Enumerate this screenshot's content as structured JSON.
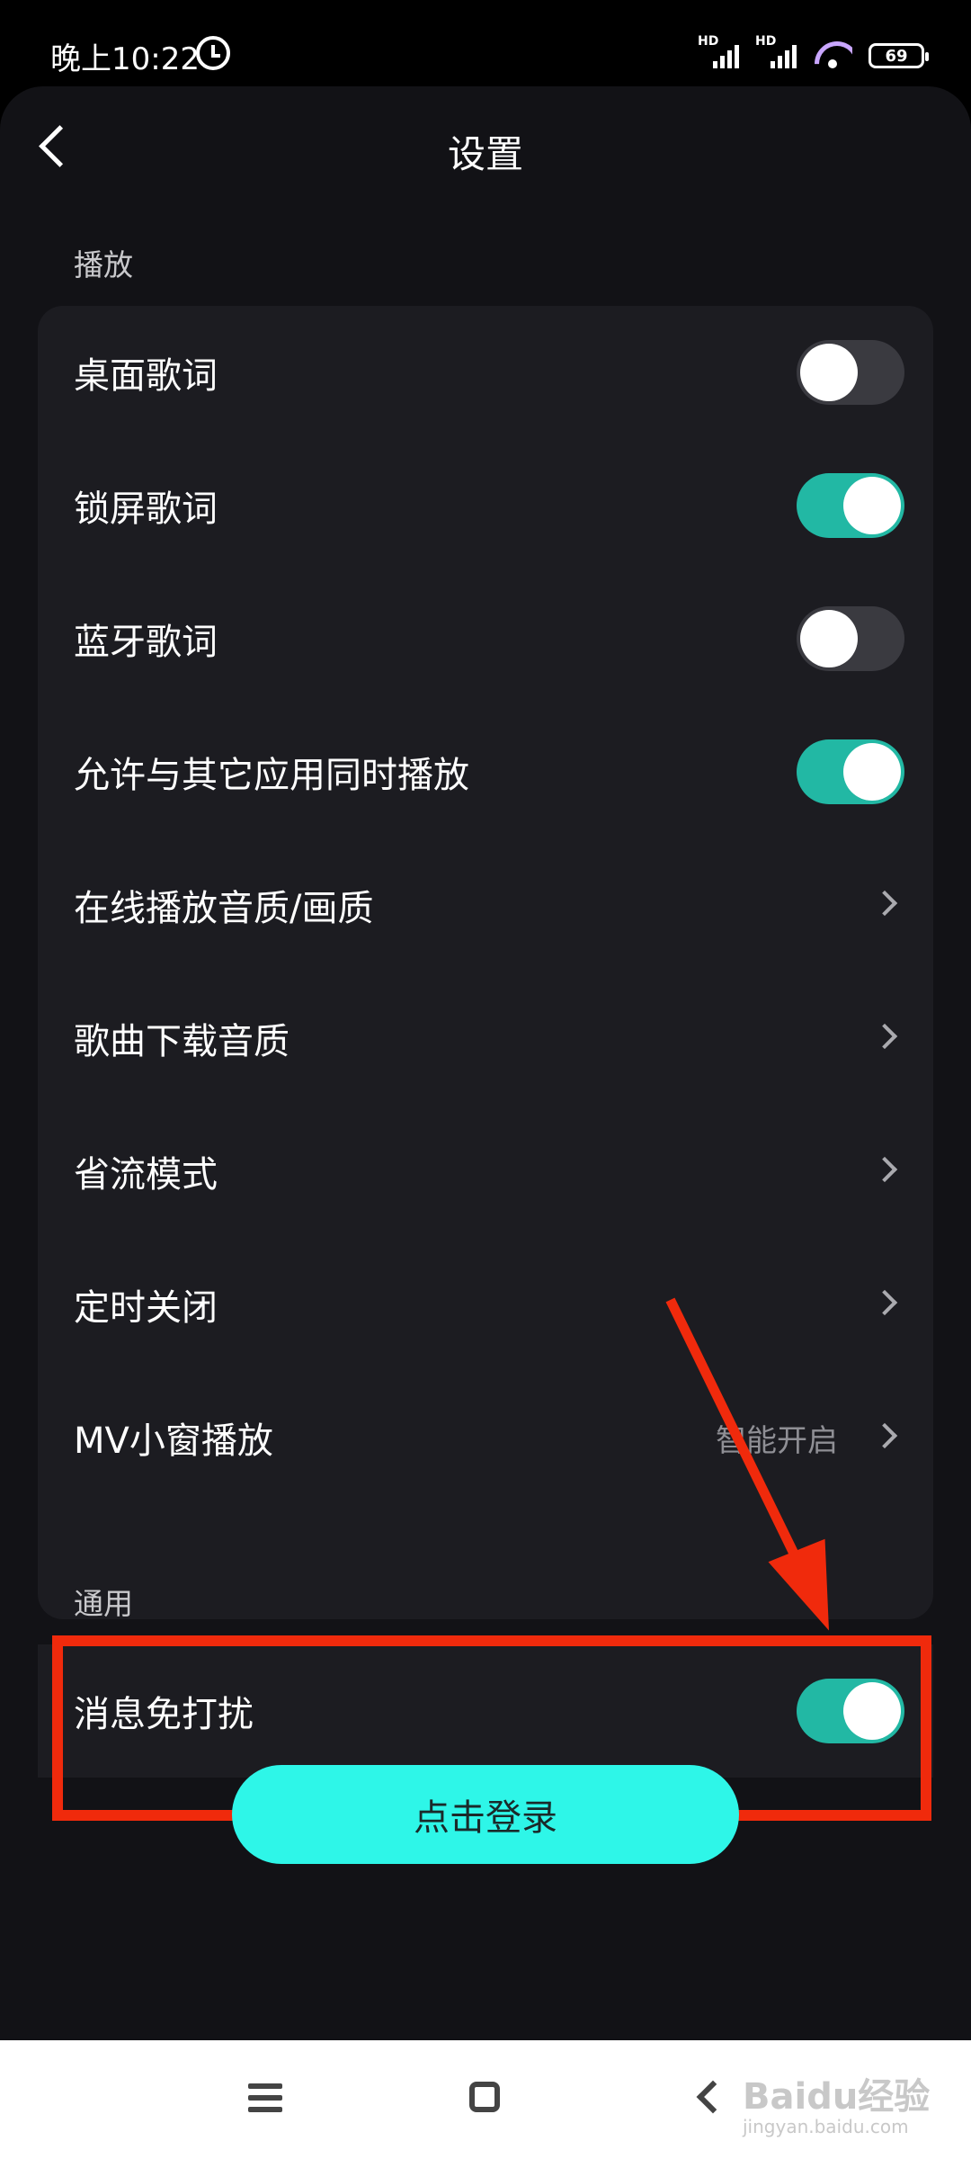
{
  "status_bar": {
    "time": "晚上10:22",
    "signal1_label": "HD",
    "signal2_label": "HD",
    "battery": "69"
  },
  "header": {
    "title": "设置"
  },
  "sections": {
    "playback": {
      "label": "播放",
      "items": [
        {
          "label": "桌面歌词",
          "type": "toggle",
          "on": false
        },
        {
          "label": "锁屏歌词",
          "type": "toggle",
          "on": true
        },
        {
          "label": "蓝牙歌词",
          "type": "toggle",
          "on": false
        },
        {
          "label": "允许与其它应用同时播放",
          "type": "toggle",
          "on": true
        },
        {
          "label": "在线播放音质/画质",
          "type": "link"
        },
        {
          "label": "歌曲下载音质",
          "type": "link"
        },
        {
          "label": "省流模式",
          "type": "link"
        },
        {
          "label": "定时关闭",
          "type": "link"
        },
        {
          "label": "MV小窗播放",
          "type": "link",
          "value": "智能开启"
        }
      ]
    },
    "general": {
      "label": "通用",
      "items": [
        {
          "label": "消息免打扰",
          "type": "toggle",
          "on": true
        }
      ]
    }
  },
  "login_button": "点击登录",
  "colors": {
    "background": "#121216",
    "card": "#1c1c21",
    "toggle_on": "#22b8a4",
    "login_button": "#2ef6e8",
    "annotation": "#f02a0c"
  },
  "watermark": {
    "main": "Baidu经验",
    "sub": "jingyan.baidu.com"
  }
}
